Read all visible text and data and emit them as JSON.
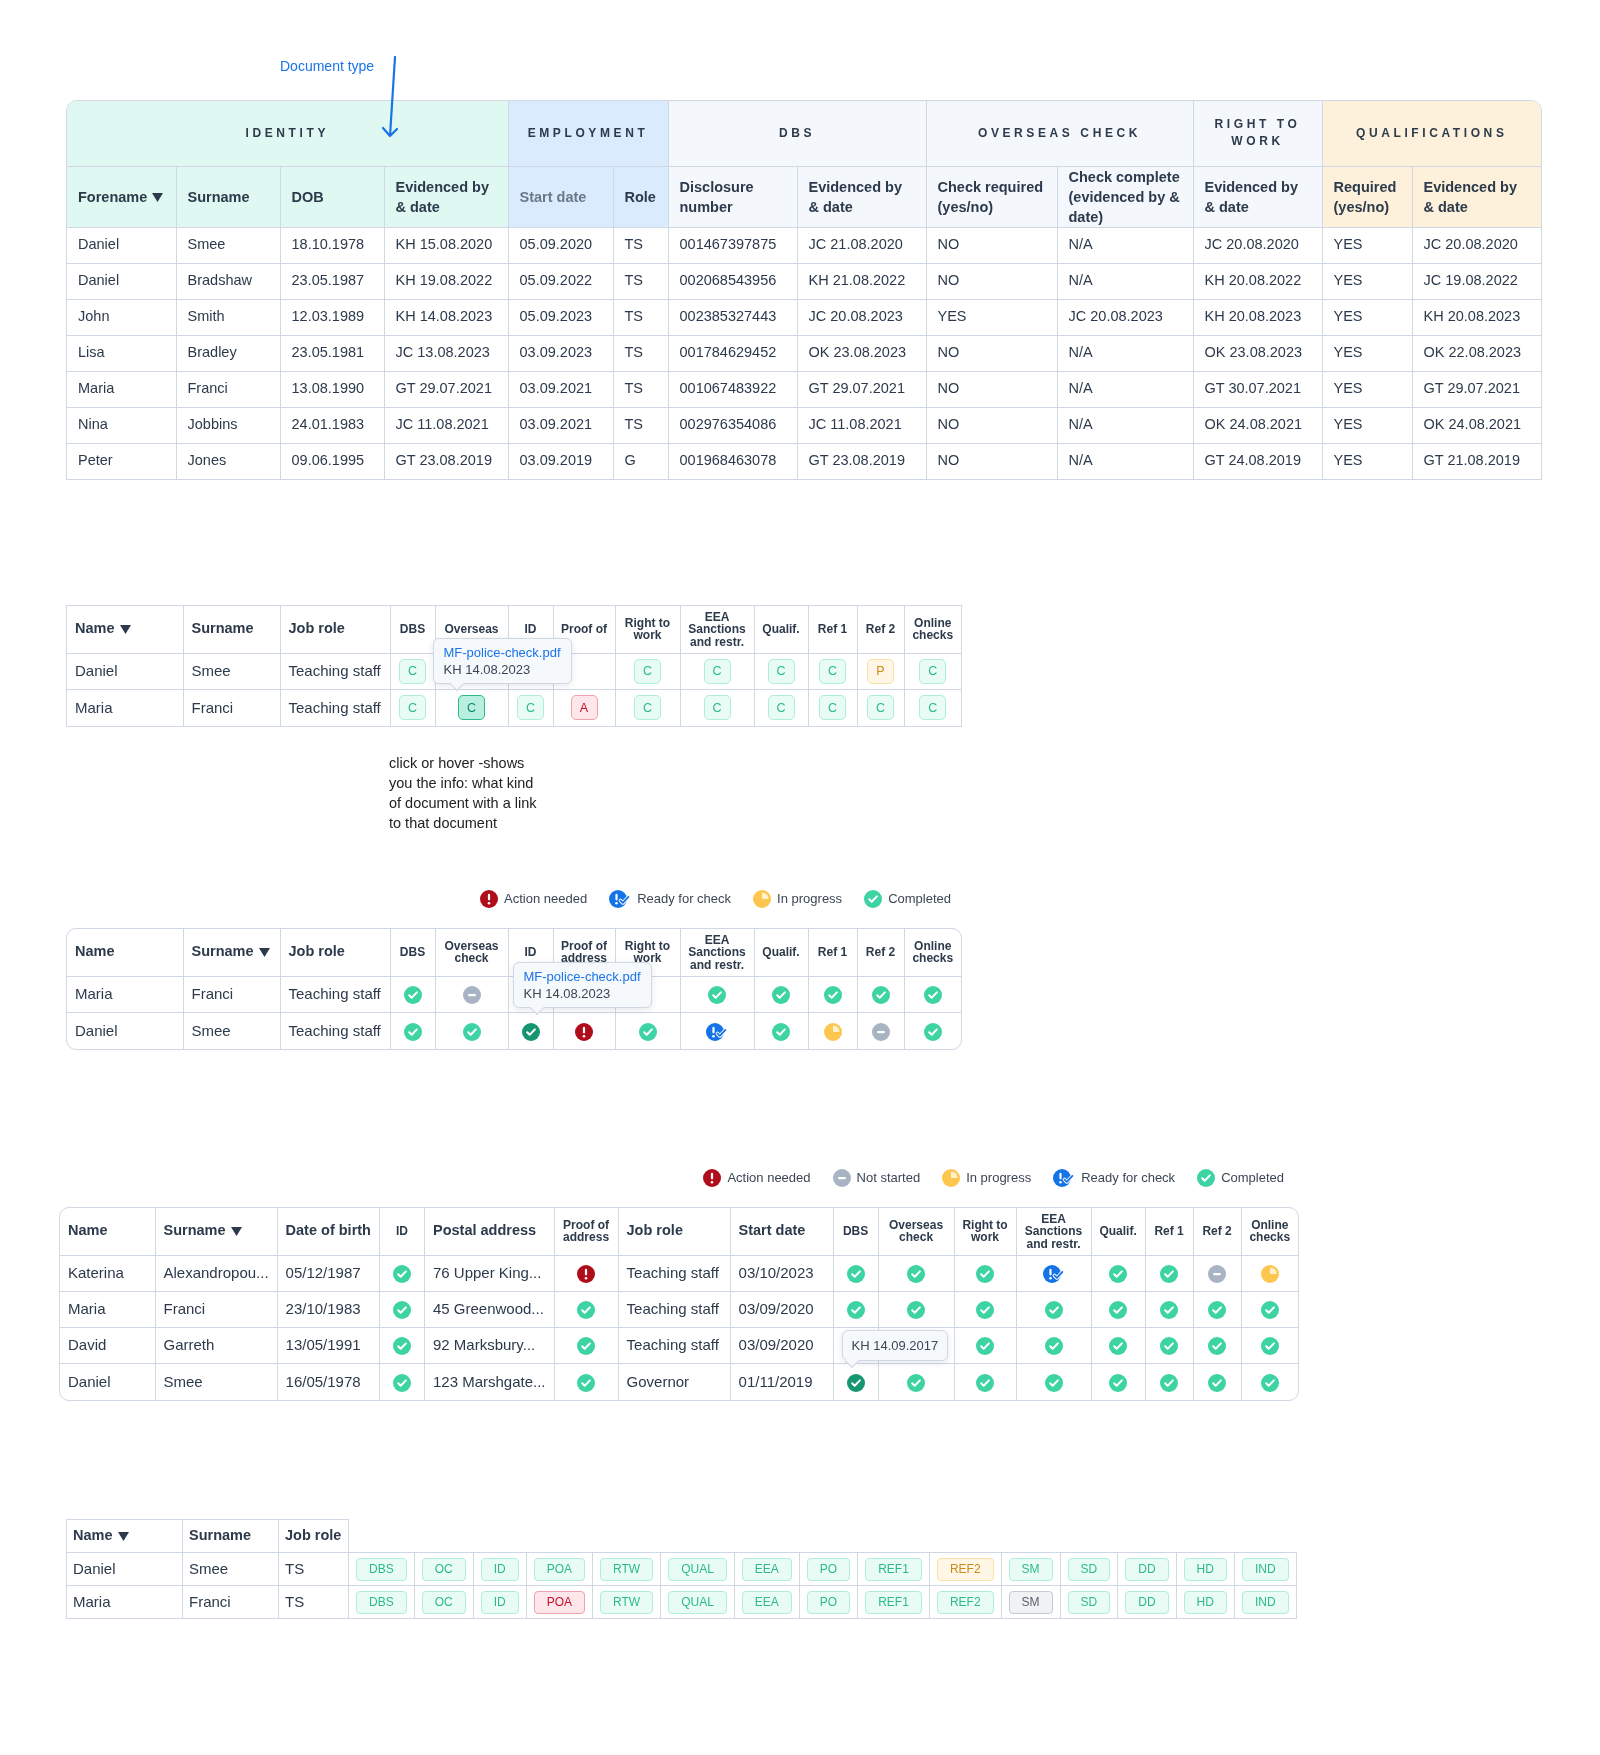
{
  "doc_type_note": "Document type",
  "records_table": {
    "groups": [
      {
        "label": "IDENTITY",
        "color": "#e0f8f2",
        "columns": [
          {
            "label": "Forename",
            "sorted": true,
            "muted": false
          },
          {
            "label": "Surname",
            "sorted": false,
            "muted": false
          },
          {
            "label": "DOB",
            "sorted": false,
            "muted": false
          },
          {
            "label": "Evidenced by & date",
            "sorted": false,
            "muted": false
          }
        ]
      },
      {
        "label": "EMPLOYMENT",
        "color": "#d9ebfd",
        "columns": [
          {
            "label": "Start date",
            "sorted": false,
            "muted": true
          },
          {
            "label": "Role",
            "sorted": false,
            "muted": false
          }
        ]
      },
      {
        "label": "DBS",
        "color": "#f4f7fb",
        "columns": [
          {
            "label": "Disclosure number",
            "sorted": false,
            "muted": false
          },
          {
            "label": "Evidenced by & date",
            "sorted": false,
            "muted": false
          }
        ]
      },
      {
        "label": "OVERSEAS CHECK",
        "color": "#f4f7fb",
        "columns": [
          {
            "label": "Check required (yes/no)",
            "sorted": false,
            "muted": false
          },
          {
            "label": "Check complete (evidenced by & date)",
            "sorted": false,
            "muted": false
          }
        ]
      },
      {
        "label": "RIGHT TO WORK",
        "color": "#f4f7fb",
        "columns": [
          {
            "label": "Evidenced by & date",
            "sorted": false,
            "muted": false
          }
        ]
      },
      {
        "label": "QUALIFICATIONS",
        "color": "#fdf1dc",
        "columns": [
          {
            "label": "Required (yes/no)",
            "sorted": false,
            "muted": false
          },
          {
            "label": "Evidenced by & date",
            "sorted": false,
            "muted": false
          }
        ]
      }
    ],
    "rows": [
      [
        "Daniel",
        "Smee",
        "18.10.1978",
        "KH 15.08.2020",
        "05.09.2020",
        "TS",
        "001467397875",
        "JC 21.08.2020",
        "NO",
        "N/A",
        "JC 20.08.2020",
        "YES",
        "JC 20.08.2020"
      ],
      [
        "Daniel",
        "Bradshaw",
        "23.05.1987",
        "KH 19.08.2022",
        "05.09.2022",
        "TS",
        "002068543956",
        "KH 21.08.2022",
        "NO",
        "N/A",
        "KH 20.08.2022",
        "YES",
        "JC 19.08.2022"
      ],
      [
        "John",
        "Smith",
        "12.03.1989",
        "KH 14.08.2023",
        "05.09.2023",
        "TS",
        "002385327443",
        "JC 20.08.2023",
        "YES",
        "JC 20.08.2023",
        "KH 20.08.2023",
        "YES",
        "KH 20.08.2023"
      ],
      [
        "Lisa",
        "Bradley",
        "23.05.1981",
        "JC 13.08.2023",
        "03.09.2023",
        "TS",
        "001784629452",
        "OK 23.08.2023",
        "NO",
        "N/A",
        "OK 23.08.2023",
        "YES",
        "OK 22.08.2023"
      ],
      [
        "Maria",
        "Franci",
        "13.08.1990",
        "GT 29.07.2021",
        "03.09.2021",
        "TS",
        "001067483922",
        "GT 29.07.2021",
        "NO",
        "N/A",
        "GT 30.07.2021",
        "YES",
        "GT 29.07.2021"
      ],
      [
        "Nina",
        "Jobbins",
        "24.01.1983",
        "JC 11.08.2021",
        "03.09.2021",
        "TS",
        "002976354086",
        "JC 11.08.2021",
        "NO",
        "N/A",
        "OK 24.08.2021",
        "YES",
        "OK 24.08.2021"
      ],
      [
        "Peter",
        "Jones",
        "09.06.1995",
        "GT 23.08.2019",
        "03.09.2019",
        "G",
        "001968463078",
        "GT 23.08.2019",
        "NO",
        "N/A",
        "GT 24.08.2019",
        "YES",
        "GT 21.08.2019"
      ]
    ]
  },
  "badge_table": {
    "columns": [
      {
        "label": "Name",
        "kind": "text",
        "sorted": true
      },
      {
        "label": "Surname",
        "kind": "text",
        "sorted": false
      },
      {
        "label": "Job role",
        "kind": "text",
        "sorted": false
      },
      {
        "label": "DBS",
        "kind": "status",
        "sorted": false
      },
      {
        "label": "Overseas",
        "kind": "status",
        "sorted": false
      },
      {
        "label": "ID",
        "kind": "status",
        "sorted": false
      },
      {
        "label": "Proof of",
        "kind": "status",
        "sorted": false
      },
      {
        "label": "Right to work",
        "kind": "status",
        "sorted": false
      },
      {
        "label": "EEA Sanctions and restr.",
        "kind": "status",
        "sorted": false
      },
      {
        "label": "Qualif.",
        "kind": "status",
        "sorted": false
      },
      {
        "label": "Ref 1",
        "kind": "status",
        "sorted": false
      },
      {
        "label": "Ref 2",
        "kind": "status",
        "sorted": false
      },
      {
        "label": "Online checks",
        "kind": "status",
        "sorted": false
      }
    ],
    "rows": [
      {
        "cells": [
          "Daniel",
          "Smee",
          "Teaching staff",
          {
            "text": "C",
            "kind": "completed"
          },
          null,
          null,
          null,
          {
            "text": "C",
            "kind": "completed"
          },
          {
            "text": "C",
            "kind": "completed"
          },
          {
            "text": "C",
            "kind": "completed"
          },
          {
            "text": "C",
            "kind": "completed"
          },
          {
            "text": "P",
            "kind": "in_progress"
          },
          {
            "text": "C",
            "kind": "completed"
          }
        ]
      },
      {
        "cells": [
          "Maria",
          "Franci",
          "Teaching staff",
          {
            "text": "C",
            "kind": "completed"
          },
          {
            "text": "C",
            "kind": "focused"
          },
          {
            "text": "C",
            "kind": "completed"
          },
          {
            "text": "A",
            "kind": "action_needed"
          },
          {
            "text": "C",
            "kind": "completed"
          },
          {
            "text": "C",
            "kind": "completed"
          },
          {
            "text": "C",
            "kind": "completed"
          },
          {
            "text": "C",
            "kind": "completed"
          },
          {
            "text": "C",
            "kind": "completed"
          },
          {
            "text": "C",
            "kind": "completed"
          }
        ]
      }
    ],
    "tooltip": {
      "link": "MF-police-check.pdf",
      "note": "KH 14.08.2023"
    }
  },
  "annotation": "click or hover -shows you the info: what kind of document with a link to that document",
  "icon_table": {
    "legend": [
      {
        "kind": "action_needed",
        "label": "Action needed"
      },
      {
        "kind": "ready_for_check",
        "label": "Ready for check"
      },
      {
        "kind": "in_progress",
        "label": "In progress"
      },
      {
        "kind": "completed",
        "label": "Completed"
      }
    ],
    "columns": [
      {
        "label": "Name",
        "kind": "text",
        "sorted": false
      },
      {
        "label": "Surname",
        "kind": "text",
        "sorted": true
      },
      {
        "label": "Job role",
        "kind": "text",
        "sorted": false
      },
      {
        "label": "DBS",
        "kind": "status",
        "sorted": false
      },
      {
        "label": "Overseas check",
        "kind": "status",
        "sorted": false
      },
      {
        "label": "ID",
        "kind": "status",
        "sorted": false
      },
      {
        "label": "Proof of address",
        "kind": "status",
        "sorted": false
      },
      {
        "label": "Right to work",
        "kind": "status",
        "sorted": false
      },
      {
        "label": "EEA Sanctions and restr.",
        "kind": "status",
        "sorted": false
      },
      {
        "label": "Qualif.",
        "kind": "status",
        "sorted": false
      },
      {
        "label": "Ref 1",
        "kind": "status",
        "sorted": false
      },
      {
        "label": "Ref 2",
        "kind": "status",
        "sorted": false
      },
      {
        "label": "Online checks",
        "kind": "status",
        "sorted": false
      }
    ],
    "rows": [
      {
        "cells": [
          "Maria",
          "Franci",
          "Teaching staff",
          {
            "kind": "completed"
          },
          {
            "kind": "not_started"
          },
          null,
          null,
          null,
          {
            "kind": "completed"
          },
          {
            "kind": "completed"
          },
          {
            "kind": "completed"
          },
          {
            "kind": "completed"
          },
          {
            "kind": "completed"
          }
        ]
      },
      {
        "cells": [
          "Daniel",
          "Smee",
          "Teaching staff",
          {
            "kind": "completed"
          },
          {
            "kind": "completed"
          },
          {
            "kind": "focused"
          },
          {
            "kind": "action_needed"
          },
          {
            "kind": "completed"
          },
          {
            "kind": "ready_for_check"
          },
          {
            "kind": "completed"
          },
          {
            "kind": "in_progress"
          },
          {
            "kind": "not_started"
          },
          {
            "kind": "completed"
          }
        ]
      }
    ],
    "tooltip": {
      "link": "MF-police-check.pdf",
      "note": "KH 14.08.2023"
    }
  },
  "overview_table": {
    "legend": [
      {
        "kind": "action_needed",
        "label": "Action needed"
      },
      {
        "kind": "not_started",
        "label": "Not started"
      },
      {
        "kind": "in_progress",
        "label": "In progress"
      },
      {
        "kind": "ready_for_check",
        "label": "Ready for check"
      },
      {
        "kind": "completed",
        "label": "Completed"
      }
    ],
    "columns": [
      {
        "label": "Name",
        "kind": "text",
        "sorted": false
      },
      {
        "label": "Surname",
        "kind": "text",
        "sorted": true
      },
      {
        "label": "Date of birth",
        "kind": "text",
        "sorted": false
      },
      {
        "label": "ID",
        "kind": "status",
        "sorted": false
      },
      {
        "label": "Postal address",
        "kind": "text",
        "sorted": false
      },
      {
        "label": "Proof of address",
        "kind": "status",
        "sorted": false
      },
      {
        "label": "Job role",
        "kind": "text",
        "sorted": false
      },
      {
        "label": "Start date",
        "kind": "text",
        "sorted": false
      },
      {
        "label": "DBS",
        "kind": "status",
        "sorted": false
      },
      {
        "label": "Overseas check",
        "kind": "status",
        "sorted": false
      },
      {
        "label": "Right to work",
        "kind": "status",
        "sorted": false
      },
      {
        "label": "EEA Sanctions and restr.",
        "kind": "status",
        "sorted": false
      },
      {
        "label": "Qualif.",
        "kind": "status",
        "sorted": false
      },
      {
        "label": "Ref 1",
        "kind": "status",
        "sorted": false
      },
      {
        "label": "Ref 2",
        "kind": "status",
        "sorted": false
      },
      {
        "label": "Online checks",
        "kind": "status",
        "sorted": false
      }
    ],
    "rows": [
      {
        "cells": [
          "Katerina",
          "Alexandropou...",
          "05/12/1987",
          {
            "kind": "completed"
          },
          "76 Upper King...",
          {
            "kind": "action_needed"
          },
          "Teaching staff",
          "03/10/2023",
          {
            "kind": "completed"
          },
          {
            "kind": "completed"
          },
          {
            "kind": "completed"
          },
          {
            "kind": "ready_for_check"
          },
          {
            "kind": "completed"
          },
          {
            "kind": "completed"
          },
          {
            "kind": "not_started"
          },
          {
            "kind": "in_progress"
          }
        ]
      },
      {
        "cells": [
          "Maria",
          "Franci",
          "23/10/1983",
          {
            "kind": "completed"
          },
          "45 Greenwood...",
          {
            "kind": "completed"
          },
          "Teaching staff",
          "03/09/2020",
          {
            "kind": "completed"
          },
          {
            "kind": "completed"
          },
          {
            "kind": "completed"
          },
          {
            "kind": "completed"
          },
          {
            "kind": "completed"
          },
          {
            "kind": "completed"
          },
          {
            "kind": "completed"
          },
          {
            "kind": "completed"
          }
        ]
      },
      {
        "cells": [
          "David",
          "Garreth",
          "13/05/1991",
          {
            "kind": "completed"
          },
          "92 Marksbury...",
          {
            "kind": "completed"
          },
          "Teaching staff",
          "03/09/2020",
          null,
          null,
          {
            "kind": "completed"
          },
          {
            "kind": "completed"
          },
          {
            "kind": "completed"
          },
          {
            "kind": "completed"
          },
          {
            "kind": "completed"
          },
          {
            "kind": "completed"
          }
        ]
      },
      {
        "cells": [
          "Daniel",
          "Smee",
          "16/05/1978",
          {
            "kind": "completed"
          },
          "123 Marshgate...",
          {
            "kind": "completed"
          },
          "Governor",
          "01/11/2019",
          {
            "kind": "focused"
          },
          {
            "kind": "completed"
          },
          {
            "kind": "completed"
          },
          {
            "kind": "completed"
          },
          {
            "kind": "completed"
          },
          {
            "kind": "completed"
          },
          {
            "kind": "completed"
          },
          {
            "kind": "completed"
          }
        ]
      }
    ],
    "tooltip": {
      "note": "KH 14.09.2017"
    }
  },
  "tag_table": {
    "columns": [
      {
        "label": "Name",
        "sorted": true
      },
      {
        "label": "Surname",
        "sorted": false
      },
      {
        "label": "Job role",
        "sorted": false
      }
    ],
    "rows": [
      {
        "cells": [
          "Daniel",
          "Smee",
          "TS"
        ],
        "tags": [
          {
            "text": "DBS",
            "kind": "completed"
          },
          {
            "text": "OC",
            "kind": "completed"
          },
          {
            "text": "ID",
            "kind": "completed"
          },
          {
            "text": "POA",
            "kind": "completed"
          },
          {
            "text": "RTW",
            "kind": "completed"
          },
          {
            "text": "QUAL",
            "kind": "completed"
          },
          {
            "text": "EEA",
            "kind": "completed"
          },
          {
            "text": "PO",
            "kind": "completed"
          },
          {
            "text": "REF1",
            "kind": "completed"
          },
          {
            "text": "REF2",
            "kind": "in_progress"
          },
          {
            "text": "SM",
            "kind": "completed"
          },
          {
            "text": "SD",
            "kind": "completed"
          },
          {
            "text": "DD",
            "kind": "completed"
          },
          {
            "text": "HD",
            "kind": "completed"
          },
          {
            "text": "IND",
            "kind": "completed"
          }
        ]
      },
      {
        "cells": [
          "Maria",
          "Franci",
          "TS"
        ],
        "tags": [
          {
            "text": "DBS",
            "kind": "completed"
          },
          {
            "text": "OC",
            "kind": "completed"
          },
          {
            "text": "ID",
            "kind": "completed"
          },
          {
            "text": "POA",
            "kind": "action_needed"
          },
          {
            "text": "RTW",
            "kind": "completed"
          },
          {
            "text": "QUAL",
            "kind": "completed"
          },
          {
            "text": "EEA",
            "kind": "completed"
          },
          {
            "text": "PO",
            "kind": "completed"
          },
          {
            "text": "REF1",
            "kind": "completed"
          },
          {
            "text": "REF2",
            "kind": "completed"
          },
          {
            "text": "SM",
            "kind": "not_started"
          },
          {
            "text": "SD",
            "kind": "completed"
          },
          {
            "text": "DD",
            "kind": "completed"
          },
          {
            "text": "HD",
            "kind": "completed"
          },
          {
            "text": "IND",
            "kind": "completed"
          }
        ]
      }
    ]
  }
}
